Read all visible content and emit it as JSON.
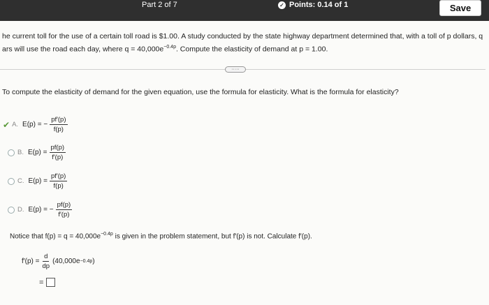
{
  "header": {
    "part": "Part 2 of 7",
    "points": "Points: 0.14 of 1",
    "save_label": "Save"
  },
  "problem": {
    "line1": "he current toll for the use of a certain toll road is $1.00. A study conducted by the state highway department determined that, with a toll of p dollars, q",
    "line2_pre": "ars will use the road each day, where q = 40,000e",
    "line2_exp": "−0.4p",
    "line2_post": ". Compute the elasticity of demand at p = 1.00."
  },
  "expand_label": "·····",
  "question": "To compute the elasticity of demand for the given equation, use the formula for elasticity. What is the formula for elasticity?",
  "options": [
    {
      "letter": "A.",
      "lhs": "E(p) = −",
      "num": "pf′(p)",
      "den": "f(p)",
      "selected_correct": true
    },
    {
      "letter": "B.",
      "lhs": "E(p) =",
      "num": "pf(p)",
      "den": "f′(p)",
      "selected_correct": false
    },
    {
      "letter": "C.",
      "lhs": "E(p) =",
      "num": "pf′(p)",
      "den": "f(p)",
      "selected_correct": false
    },
    {
      "letter": "D.",
      "lhs": "E(p) = −",
      "num": "pf(p)",
      "den": "f′(p)",
      "selected_correct": false
    }
  ],
  "notice": {
    "pre": "Notice that f(p) = q = 40,000e",
    "exp": "−0.4p",
    "post": " is given in the problem statement, but f′(p) is not. Calculate f′(p)."
  },
  "derivative": {
    "lhs": "f′(p) =",
    "d_num": "d",
    "d_den": "dp",
    "expr_pre": "(40,000e",
    "expr_exp": "−0.4p",
    "expr_post": ")"
  },
  "answer": {
    "eq": "="
  }
}
